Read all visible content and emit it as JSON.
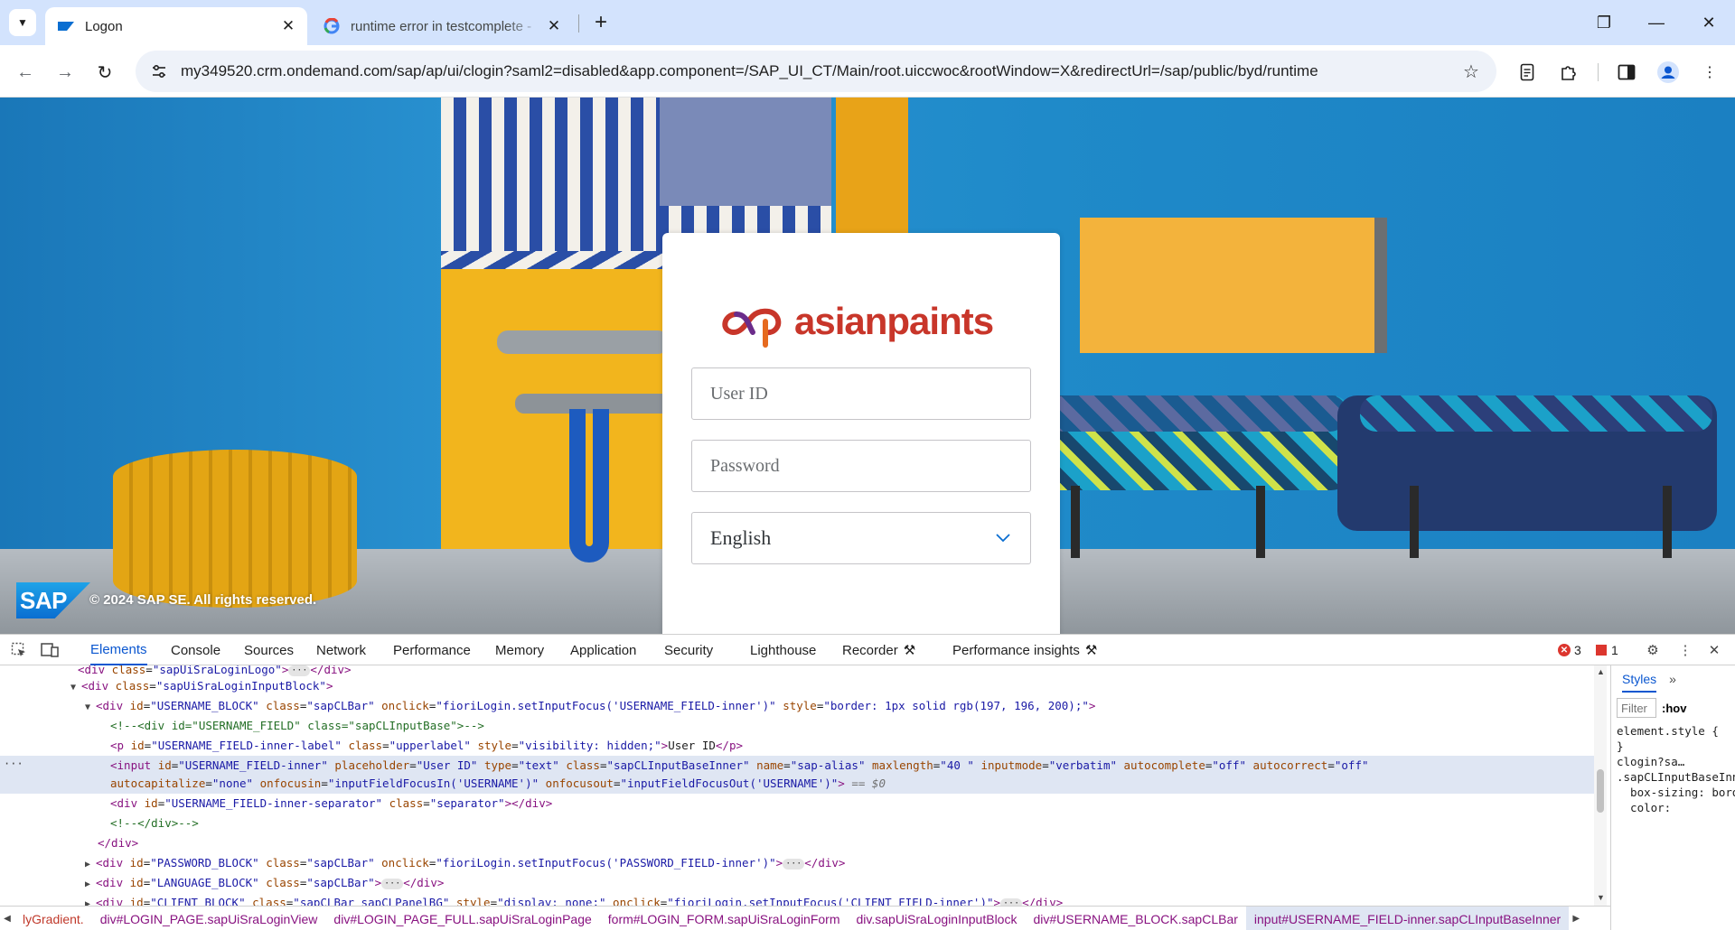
{
  "browser": {
    "tabs": [
      {
        "title": "Logon",
        "favicon": "sap-favicon",
        "active": true
      },
      {
        "title": "runtime error in testcomplete -",
        "favicon": "google-g-icon",
        "active": false
      }
    ],
    "url": "my349520.crm.ondemand.com/sap/ap/ui/clogin?saml2=disabled&app.component=/SAP_UI_CT/Main/root.uiccwoc&rootWindow=X&redirectUrl=/sap/public/byd/runtime"
  },
  "login": {
    "brand": "asianpaints",
    "user_id_placeholder": "User ID",
    "password_placeholder": "Password",
    "language": "English",
    "sap_logo": "SAP",
    "copyright": "© 2024 SAP SE. All rights reserved."
  },
  "devtools": {
    "tabs": [
      "Elements",
      "Console",
      "Sources",
      "Network",
      "Performance",
      "Memory",
      "Application",
      "Security",
      "Lighthouse",
      "Recorder",
      "Performance insights"
    ],
    "active_tab": "Elements",
    "errors": "3",
    "issues": "1",
    "dom_lines": [
      "<div class=\"sapUiSraLoginLogo\">…</div>",
      "<div class=\"sapUiSraLoginInputBlock\">",
      "<div id=\"USERNAME_BLOCK\" class=\"sapCLBar\" onclick=\"fioriLogin.setInputFocus('USERNAME_FIELD-inner')\" style=\"border: 1px solid rgb(197, 196, 200);\">",
      "<!--<div id=\"USERNAME_FIELD\" class=\"sapCLInputBase\">-->",
      "<p id=\"USERNAME_FIELD-inner-label\" class=\"upperlabel\" style=\"visibility: hidden;\">User ID</p>",
      "<input id=\"USERNAME_FIELD-inner\" placeholder=\"User ID\" type=\"text\" class=\"sapCLInputBaseInner\" name=\"sap-alias\" maxlength=\"40 \" inputmode=\"verbatim\" autocomplete=\"off\" autocorrect=\"off\"",
      "autocapitalize=\"none\" onfocusin=\"inputFieldFocusIn('USERNAME')\" onfocusout=\"inputFieldFocusOut('USERNAME')\"> == $0",
      "<div id=\"USERNAME_FIELD-inner-separator\" class=\"separator\"></div>",
      "<!--</div>-->",
      "</div>",
      "<div id=\"PASSWORD_BLOCK\" class=\"sapCLBar\" onclick=\"fioriLogin.setInputFocus('PASSWORD_FIELD-inner')\">…</div>",
      "<div id=\"LANGUAGE_BLOCK\" class=\"sapCLBar\">…</div>",
      "<div id=\"CLIENT_BLOCK\" class=\"sapCLBar sapCLPanelBG\" style=\"display: none;\" onclick=\"fioriLogin.setInputFocus('CLIENT_FIELD-inner')\">…</div>"
    ],
    "styles": {
      "tab": "Styles",
      "filter_placeholder": "Filter",
      "hov": ":hov",
      "code": "element.style {\n}\nclogin?sa…\n.sapCLInputBaseInner {\n  box-sizing: border-box;\n  color:"
    },
    "breadcrumbs": [
      "lyGradient.",
      "div#LOGIN_PAGE.sapUiSraLoginView",
      "div#LOGIN_PAGE_FULL.sapUiSraLoginPage",
      "form#LOGIN_FORM.sapUiSraLoginForm",
      "div.sapUiSraLoginInputBlock",
      "div#USERNAME_BLOCK.sapCLBar",
      "input#USERNAME_FIELD-inner.sapCLInputBaseInner"
    ]
  }
}
